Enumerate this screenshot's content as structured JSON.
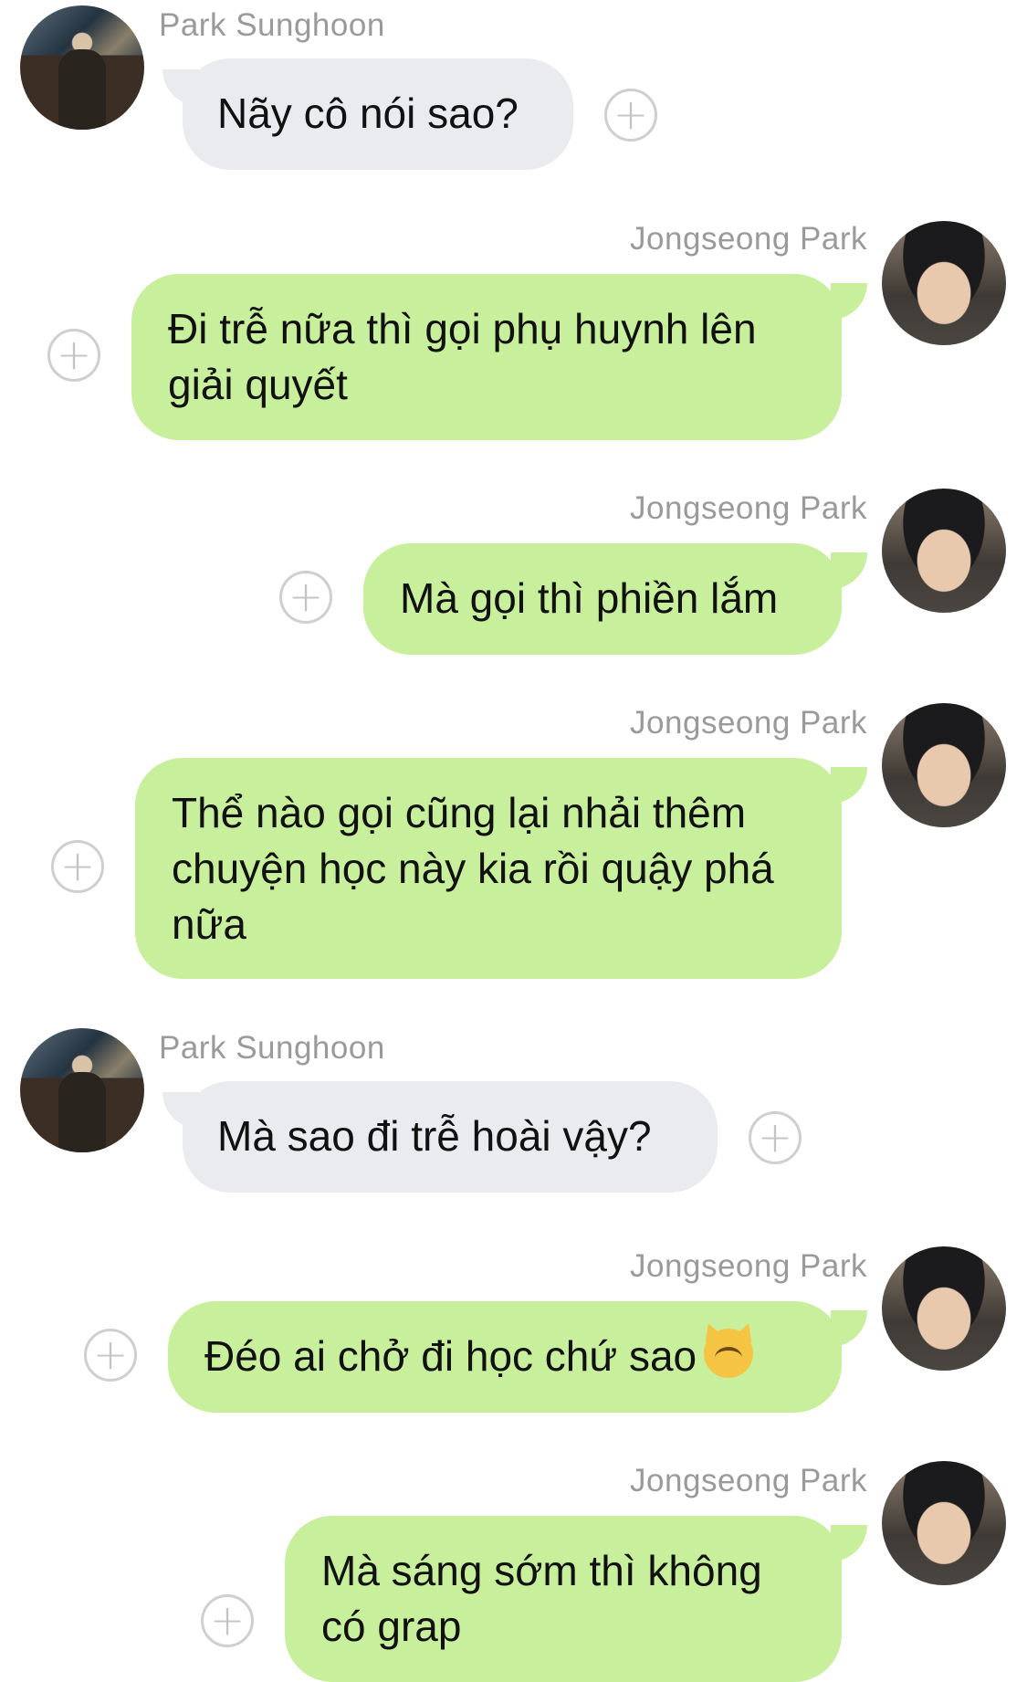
{
  "messages": [
    {
      "sender": "Park Sunghoon",
      "text": "Nãy cô nói sao?",
      "side": "in"
    },
    {
      "sender": "Jongseong Park",
      "text": "Đi trễ nữa thì gọi phụ huynh lên giải quyết",
      "side": "out"
    },
    {
      "sender": "Jongseong Park",
      "text": "Mà gọi thì phiền lắm",
      "side": "out"
    },
    {
      "sender": "Jongseong Park",
      "text": "Thể nào gọi cũng lại nhải thêm chuyện học này kia rồi quậy phá nữa",
      "side": "out"
    },
    {
      "sender": "Park Sunghoon",
      "text": "Mà sao đi trễ hoài vậy?",
      "side": "in"
    },
    {
      "sender": "Jongseong Park",
      "text": "Đéo ai chở đi học chứ sao",
      "side": "out",
      "emoji": "angry-cat-emoji"
    },
    {
      "sender": "Jongseong Park",
      "text": "Mà sáng sớm thì không có grap",
      "side": "out"
    }
  ],
  "colors": {
    "incoming_bubble": "#e9ebee",
    "outgoing_bubble": "#c8ef9b",
    "sender_name": "#9a9a9a"
  },
  "icons": {
    "add_reaction": "plus-circle-icon"
  }
}
